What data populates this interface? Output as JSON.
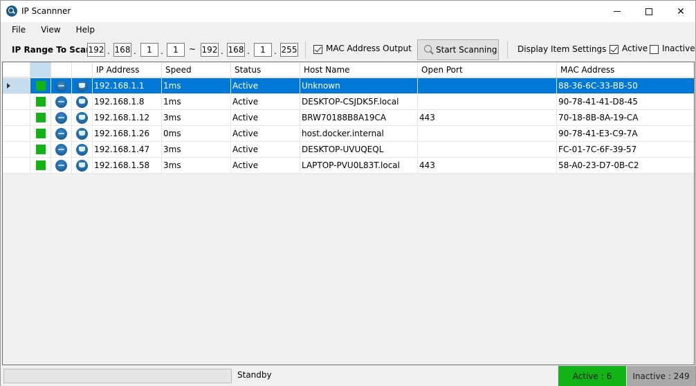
{
  "window": {
    "title": "IP Scannner"
  },
  "menu": {
    "file": "File",
    "view": "View",
    "help": "Help"
  },
  "toolbar": {
    "ip_range_label": "IP Range To Scan",
    "start": [
      "192",
      "168",
      "1",
      "1"
    ],
    "end": [
      "192",
      "168",
      "1",
      "255"
    ],
    "dot": ".",
    "tilde": "~",
    "mac_output_label": "MAC Address Output",
    "mac_output_checked": true,
    "scan_button_label": "Start Scanning",
    "display_settings_label": "Display Item Settings :",
    "active_label": "Active",
    "active_checked": true,
    "inactive_label": "Inactive",
    "inactive_checked": false
  },
  "grid": {
    "columns": [
      "IP Address",
      "Speed",
      "Status",
      "Host Name",
      "Open Port",
      "MAC Address"
    ],
    "rows": [
      {
        "ip": "192.168.1.1",
        "speed": "1ms",
        "status": "Active",
        "host": "Unknown",
        "port": "",
        "mac": "88-36-6C-33-BB-50",
        "selected": true
      },
      {
        "ip": "192.168.1.8",
        "speed": "1ms",
        "status": "Active",
        "host": "DESKTOP-CSJDK5F.local",
        "port": "",
        "mac": "90-78-41-41-D8-45",
        "selected": false
      },
      {
        "ip": "192.168.1.12",
        "speed": "3ms",
        "status": "Active",
        "host": "BRW70188B8A19CA",
        "port": "443",
        "mac": "70-18-8B-8A-19-CA",
        "selected": false
      },
      {
        "ip": "192.168.1.26",
        "speed": "0ms",
        "status": "Active",
        "host": "host.docker.internal",
        "port": "",
        "mac": "90-78-41-E3-C9-7A",
        "selected": false
      },
      {
        "ip": "192.168.1.47",
        "speed": "3ms",
        "status": "Active",
        "host": "DESKTOP-UVUQEQL",
        "port": "",
        "mac": "FC-01-7C-6F-39-57",
        "selected": false
      },
      {
        "ip": "192.168.1.58",
        "speed": "3ms",
        "status": "Active",
        "host": "LAPTOP-PVU0L83T.local",
        "port": "443",
        "mac": "58-A0-23-D7-0B-C2",
        "selected": false
      }
    ]
  },
  "statusbar": {
    "progress_fraction": 0,
    "status_text": "Standby",
    "active_text": "Active : 6",
    "inactive_text": "Inactive : 249"
  },
  "colors": {
    "active_green": "#11b316",
    "selection_blue": "#0078d7",
    "inactive_gray": "#a9a9a9"
  },
  "icons": {
    "app": "ip-scanner-icon",
    "status": "green-status-square",
    "ping": "ping-icon",
    "host": "host-icon",
    "search": "search-icon"
  }
}
